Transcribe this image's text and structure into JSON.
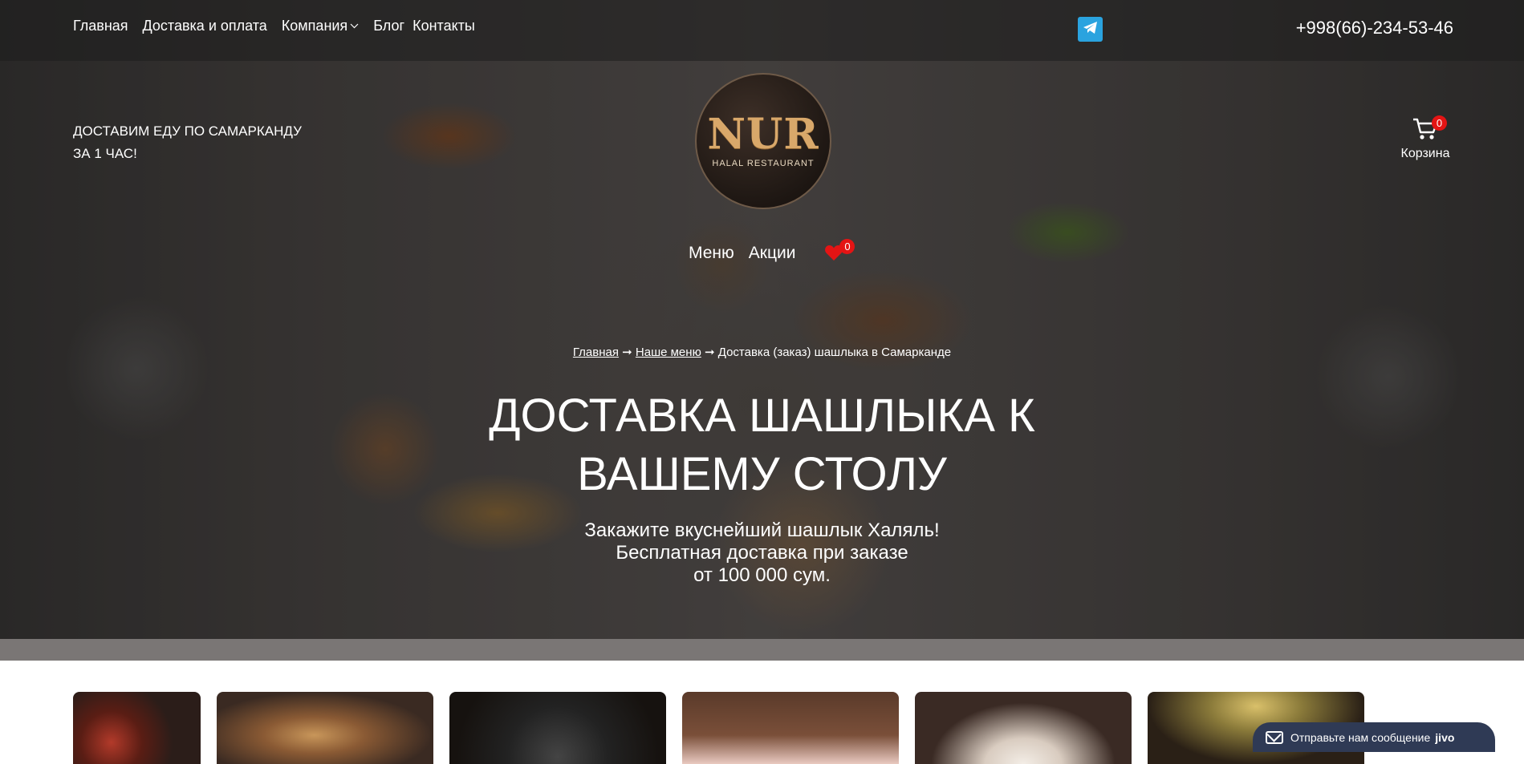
{
  "nav": {
    "items": [
      {
        "label": "Главная"
      },
      {
        "label": "Доставка и оплата"
      },
      {
        "label": "Компания",
        "has_dropdown": true
      },
      {
        "label": "Блог"
      },
      {
        "label": "Контакты"
      }
    ]
  },
  "header": {
    "phone": "+998(66)-234-53-46",
    "tagline_line1": "ДОСТАВИМ ЕДУ ПО САМАРКАНДУ",
    "tagline_line2": "ЗА 1 ЧАС!",
    "telegram_icon": "telegram-icon",
    "cart": {
      "label": "Корзина",
      "count": "0",
      "icon": "cart-icon"
    }
  },
  "logo": {
    "main": "NUR",
    "sub": "HALAL RESTAURANT"
  },
  "secondary_nav": {
    "items": [
      {
        "label": "Меню"
      },
      {
        "label": "Акции"
      }
    ],
    "favorites": {
      "count": "0",
      "icon": "heart-icon"
    }
  },
  "breadcrumb": {
    "home": "Главная",
    "sep1": "➞",
    "menu": "Наше меню",
    "sep2": "➞",
    "current": "Доставка (заказ) шашлыка в Самарканде"
  },
  "hero": {
    "title_line1": "ДОСТАВКА ШАШЛЫКА К",
    "title_line2": "ВАШЕМУ СТОЛУ",
    "sub_line1": "Закажите вкуснейший шашлык Халяль!",
    "sub_line2": "Бесплатная доставка при заказе",
    "sub_line3": "от 100 000 сум."
  },
  "chat_widget": {
    "label": "Отправьте нам сообщение",
    "brand": "jivo"
  },
  "colors": {
    "accent_red": "#e41414",
    "telegram": "#2aa3df",
    "chat_bg": "#2f3a55"
  }
}
